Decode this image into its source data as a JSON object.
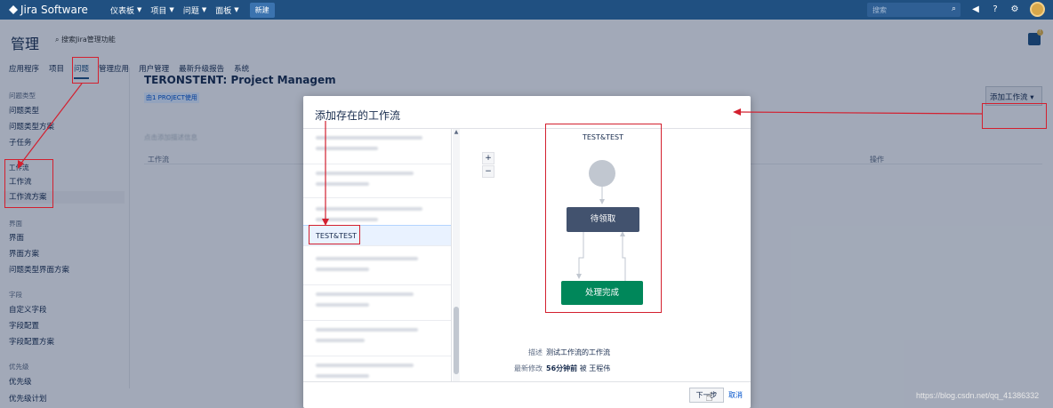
{
  "topnav": {
    "logo": "Jira Software",
    "items": [
      "仪表板",
      "项目",
      "问题",
      "面板"
    ],
    "create_label": "新建",
    "search_placeholder": "搜索"
  },
  "admin": {
    "title": "管理",
    "search_label": "搜索Jira管理功能",
    "tabs": [
      "应用程序",
      "项目",
      "问题",
      "管理应用",
      "用户管理",
      "最新升级报告",
      "系统"
    ],
    "active_tab": "问题"
  },
  "sidebar": {
    "groups": [
      {
        "title": "问题类型",
        "items": [
          "问题类型",
          "问题类型方案",
          "子任务"
        ]
      },
      {
        "title": "工作流",
        "items": [
          "工作流",
          "工作流方案"
        ]
      },
      {
        "title": "界面",
        "items": [
          "界面",
          "界面方案",
          "问题类型界面方案"
        ]
      },
      {
        "title": "字段",
        "items": [
          "自定义字段",
          "字段配置",
          "字段配置方案"
        ]
      },
      {
        "title": "优先级",
        "items": [
          "优先级",
          "优先级计划"
        ]
      }
    ],
    "active_item": "工作流方案"
  },
  "content": {
    "title": "TERONSTENT: Project Managem",
    "project_tag": "由1 PROJECT使用",
    "description": "点击添加描述信息",
    "col_workflow": "工作流",
    "col_actions": "操作",
    "add_workflow_label": "添加工作流"
  },
  "modal": {
    "title": "添加存在的工作流",
    "selected_workflow": "TEST&TEST",
    "diagram_title": "TEST&TEST",
    "zoom_in": "+",
    "zoom_out": "−",
    "status_todo": "待领取",
    "status_done": "处理完成",
    "desc_label": "描述",
    "desc_value": "测试工作流的工作流",
    "modified_label": "最新修改",
    "modified_time": "56分钟前",
    "modified_by_prefix": "被",
    "modified_by": "王程伟",
    "next_label": "下一步",
    "cancel_label": "取消"
  },
  "watermark": "https://blog.csdn.net/qq_41386332",
  "colors": {
    "nav": "#205081",
    "annotation": "#d3202f",
    "done": "#00875a",
    "todo": "#42526e"
  }
}
